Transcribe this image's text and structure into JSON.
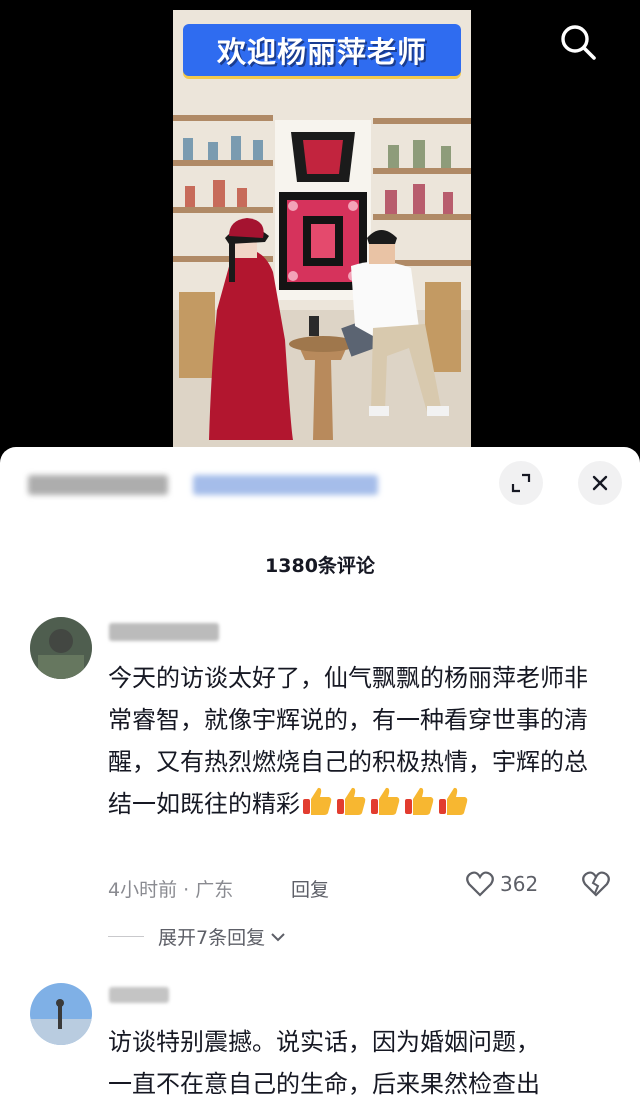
{
  "video": {
    "banner_text": "欢迎杨丽萍老师"
  },
  "sheet": {
    "author_blurred": "",
    "comment_count": "1380条评论"
  },
  "comments": [
    {
      "user": "",
      "text": "今天的访谈太好了，仙气飘飘的杨丽萍老师非常睿智，就像宇辉说的，有一种看穿世事的清醒，又有热烈燃烧自己的积极热情，宇辉的总结一如既往的精彩",
      "emoji": [
        "thumbs-up",
        "thumbs-up",
        "thumbs-up",
        "thumbs-up",
        "thumbs-up"
      ],
      "time_location": "4小时前 · 广东",
      "reply_label": "回复",
      "likes": "362",
      "expand_label": "展开7条回复"
    },
    {
      "user": "",
      "text_lines": [
        "访谈特别震撼。说实话，因为婚姻问题，",
        "一直不在意自己的生命，后来果然检查出"
      ]
    }
  ],
  "colors": {
    "banner_bg": "#2f6cf0",
    "text_primary": "#161823",
    "text_secondary": "#8a8b91"
  }
}
